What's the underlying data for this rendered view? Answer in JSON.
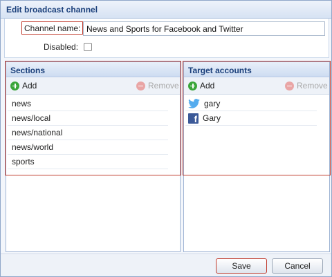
{
  "dialog": {
    "title": "Edit broadcast channel",
    "channel_name_label": "Channel name:",
    "channel_name_value": "News and Sports for Facebook and Twitter",
    "disabled_label": "Disabled:",
    "disabled_checked": false
  },
  "sections": {
    "title": "Sections",
    "add_label": "Add",
    "remove_label": "Remove",
    "items": [
      "news",
      "news/local",
      "news/national",
      "news/world",
      "sports"
    ]
  },
  "targets": {
    "title": "Target accounts",
    "add_label": "Add",
    "remove_label": "Remove",
    "items": [
      {
        "label": "gary",
        "icon": "twitter-icon"
      },
      {
        "label": "Gary",
        "icon": "facebook-icon"
      }
    ]
  },
  "footer": {
    "save_label": "Save",
    "cancel_label": "Cancel"
  },
  "colors": {
    "title_text": "#1a3f7a",
    "highlight": "#c0392b",
    "twitter": "#55acee",
    "facebook": "#3b5998"
  }
}
